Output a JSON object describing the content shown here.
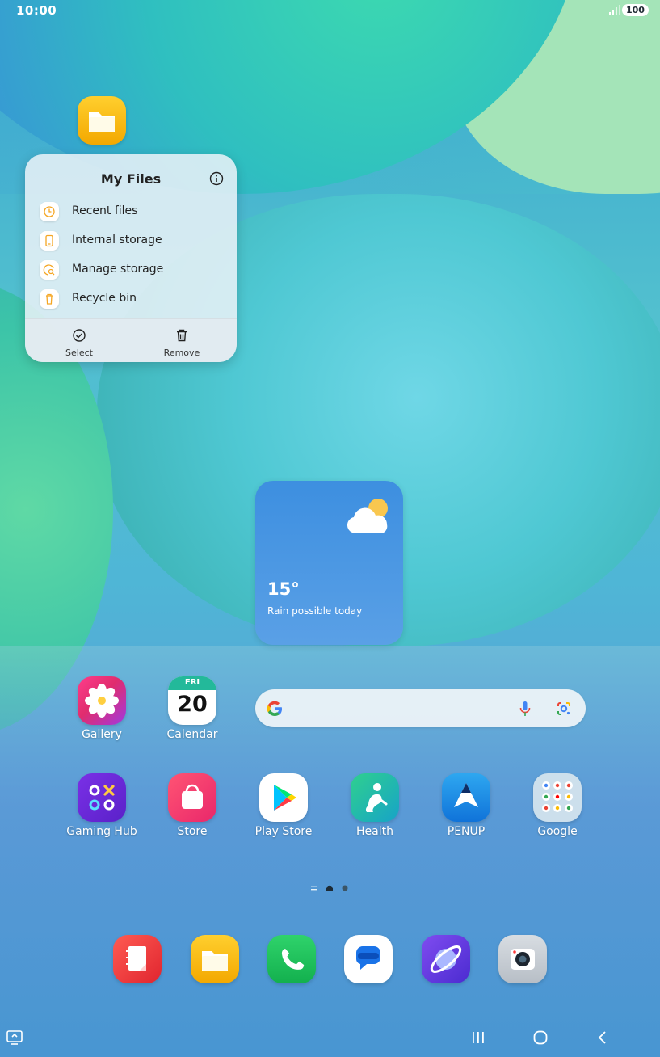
{
  "status_bar": {
    "time": "10:00",
    "battery": "100"
  },
  "popup": {
    "title": "My Files",
    "items": [
      {
        "label": "Recent files",
        "icon": "clock-icon"
      },
      {
        "label": "Internal storage",
        "icon": "phone-storage-icon"
      },
      {
        "label": "Manage storage",
        "icon": "storage-search-icon"
      },
      {
        "label": "Recycle bin",
        "icon": "trash-icon"
      }
    ],
    "actions": [
      {
        "label": "Select",
        "icon": "check-circle-icon"
      },
      {
        "label": "Remove",
        "icon": "trash-icon"
      }
    ]
  },
  "weather": {
    "temperature": "15°",
    "forecast": "Rain possible today",
    "icon": "partly-cloudy-icon"
  },
  "calendar": {
    "day": "FRI",
    "date": "20"
  },
  "apps_row1": [
    {
      "label": "Gallery"
    },
    {
      "label": "Calendar"
    }
  ],
  "apps_row2": [
    {
      "label": "Gaming Hub"
    },
    {
      "label": "Store"
    },
    {
      "label": "Play Store"
    },
    {
      "label": "Health"
    },
    {
      "label": "PENUP"
    },
    {
      "label": "Google"
    }
  ],
  "dock": [
    {
      "name": "Notes",
      "icon": "notes-icon"
    },
    {
      "name": "My Files",
      "icon": "folder-icon"
    },
    {
      "name": "Phone",
      "icon": "phone-icon"
    },
    {
      "name": "Messages",
      "icon": "messages-icon"
    },
    {
      "name": "Internet",
      "icon": "internet-icon"
    },
    {
      "name": "Camera",
      "icon": "camera-icon"
    }
  ],
  "colors": {
    "accent_orange": "#f5a623",
    "weather_bg": "#4a95e3",
    "folder_yellow": "#f6b700"
  }
}
